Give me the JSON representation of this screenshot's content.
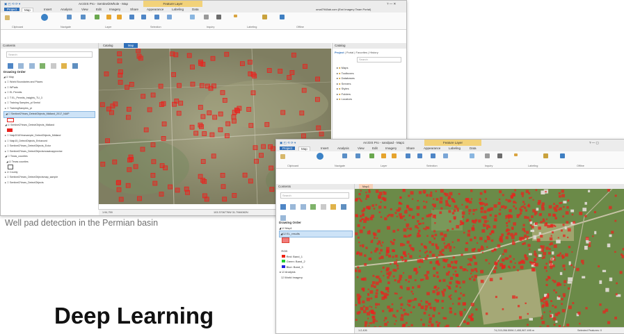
{
  "caption": "Well pad detection in the Permian basin",
  "headline": "Deep Learning",
  "window1": {
    "title": "ArcGIS Pro - Sentinel2Whole - Map",
    "context_tab": "Feature Layer",
    "account": "omal7948ab.com (Esri Imagery Team Portal)",
    "tabs": [
      "Project",
      "Map",
      "Insert",
      "Analysis",
      "View",
      "Edit",
      "Imagery",
      "Share",
      "Appearance",
      "Labeling",
      "Data"
    ],
    "ribbon_groups": [
      "Clipboard",
      "Navigate",
      "Layer",
      "Selection",
      "Inquiry",
      "Labeling",
      "Offline"
    ],
    "ribbon_buttons": [
      "Explore",
      "Bookmarks",
      "Go To XY",
      "Basemap",
      "Add Data",
      "Add Preset",
      "Select",
      "Select By Attributes",
      "Select By Location",
      "Attributes",
      "Clear",
      "Infographics",
      "Measure",
      "Locate",
      "Pause",
      "View Unplaced",
      "More",
      "Convert To Annotation",
      "Download Map",
      "Sync",
      "Remove"
    ],
    "contents": {
      "header": "Contents",
      "search_placeholder": "Search",
      "section": "Drawing Order",
      "items": [
        "Map",
        "World Boundaries and Places",
        "WPads",
        "EL Permits",
        "T EL_Permits_Insights_TU_3",
        "Training Samples_pt Sentol",
        "TrainingSamples_pt",
        "Sentinel2Years_DetectObjects_Midland_2017_NAIP",
        "Sentinel2Years_DetectObjects_Midland",
        "Naip2018Yearsample_DetectObjects_Midland",
        "Naip15_DetectObjects_Enhanced",
        "Sentinel2Years_DetectObjects_Ector",
        "Sentinel2Years_DetectObjectsmosaicapprovise",
        "Texas_counties",
        "Texas counties",
        "County",
        "Sentinel2Years_DetectObjectsmap_sample",
        "Sentinel2Years_DetectObjects"
      ]
    },
    "view_tabs": [
      "Catalog",
      "Map"
    ],
    "catalog": {
      "header": "Catalog",
      "tabs": [
        "Project",
        "Portal",
        "Favorites",
        "History"
      ],
      "search_placeholder": "Search",
      "items": [
        "Maps",
        "Toolboxes",
        "Databases",
        "Servers",
        "Styles",
        "Folders",
        "Locators"
      ]
    },
    "status": {
      "scale": "1:94,759",
      "coords": "103.3706776W 31.7946082N"
    }
  },
  "window2": {
    "title": "ArcGIS Pro - sandpad - Map1",
    "context_tab": "Feature Layer",
    "tabs": [
      "Project",
      "Map",
      "Insert",
      "Analysis",
      "View",
      "Edit",
      "Imagery",
      "Share",
      "Appearance",
      "Labeling",
      "Data"
    ],
    "ribbon_groups": [
      "Clipboard",
      "Navigate",
      "Layer",
      "Selection",
      "Inquiry",
      "Labeling",
      "Offline"
    ],
    "contents": {
      "header": "Contents",
      "search_placeholder": "Search",
      "section": "Drawing Order",
      "items": [
        "Map1",
        "EL_results",
        "RGB",
        "Red: Band_1",
        "Green: Band_2",
        "Blue: Band_3",
        "Analysis",
        "World Imagery"
      ]
    },
    "view_tab": "Map1",
    "status": {
      "scale": "1:2,426",
      "coords": "74,215,056.5596 2,455,967.495 m",
      "extra": "Selected Features: 0"
    }
  },
  "colors": {
    "accent": "#2f6fb8",
    "detection": "#e8231e",
    "context_tab": "#f2d27a"
  },
  "icons": [
    "search-icon",
    "folder-icon",
    "map-icon",
    "layer-icon",
    "close-icon",
    "pin-icon",
    "globe-icon"
  ]
}
